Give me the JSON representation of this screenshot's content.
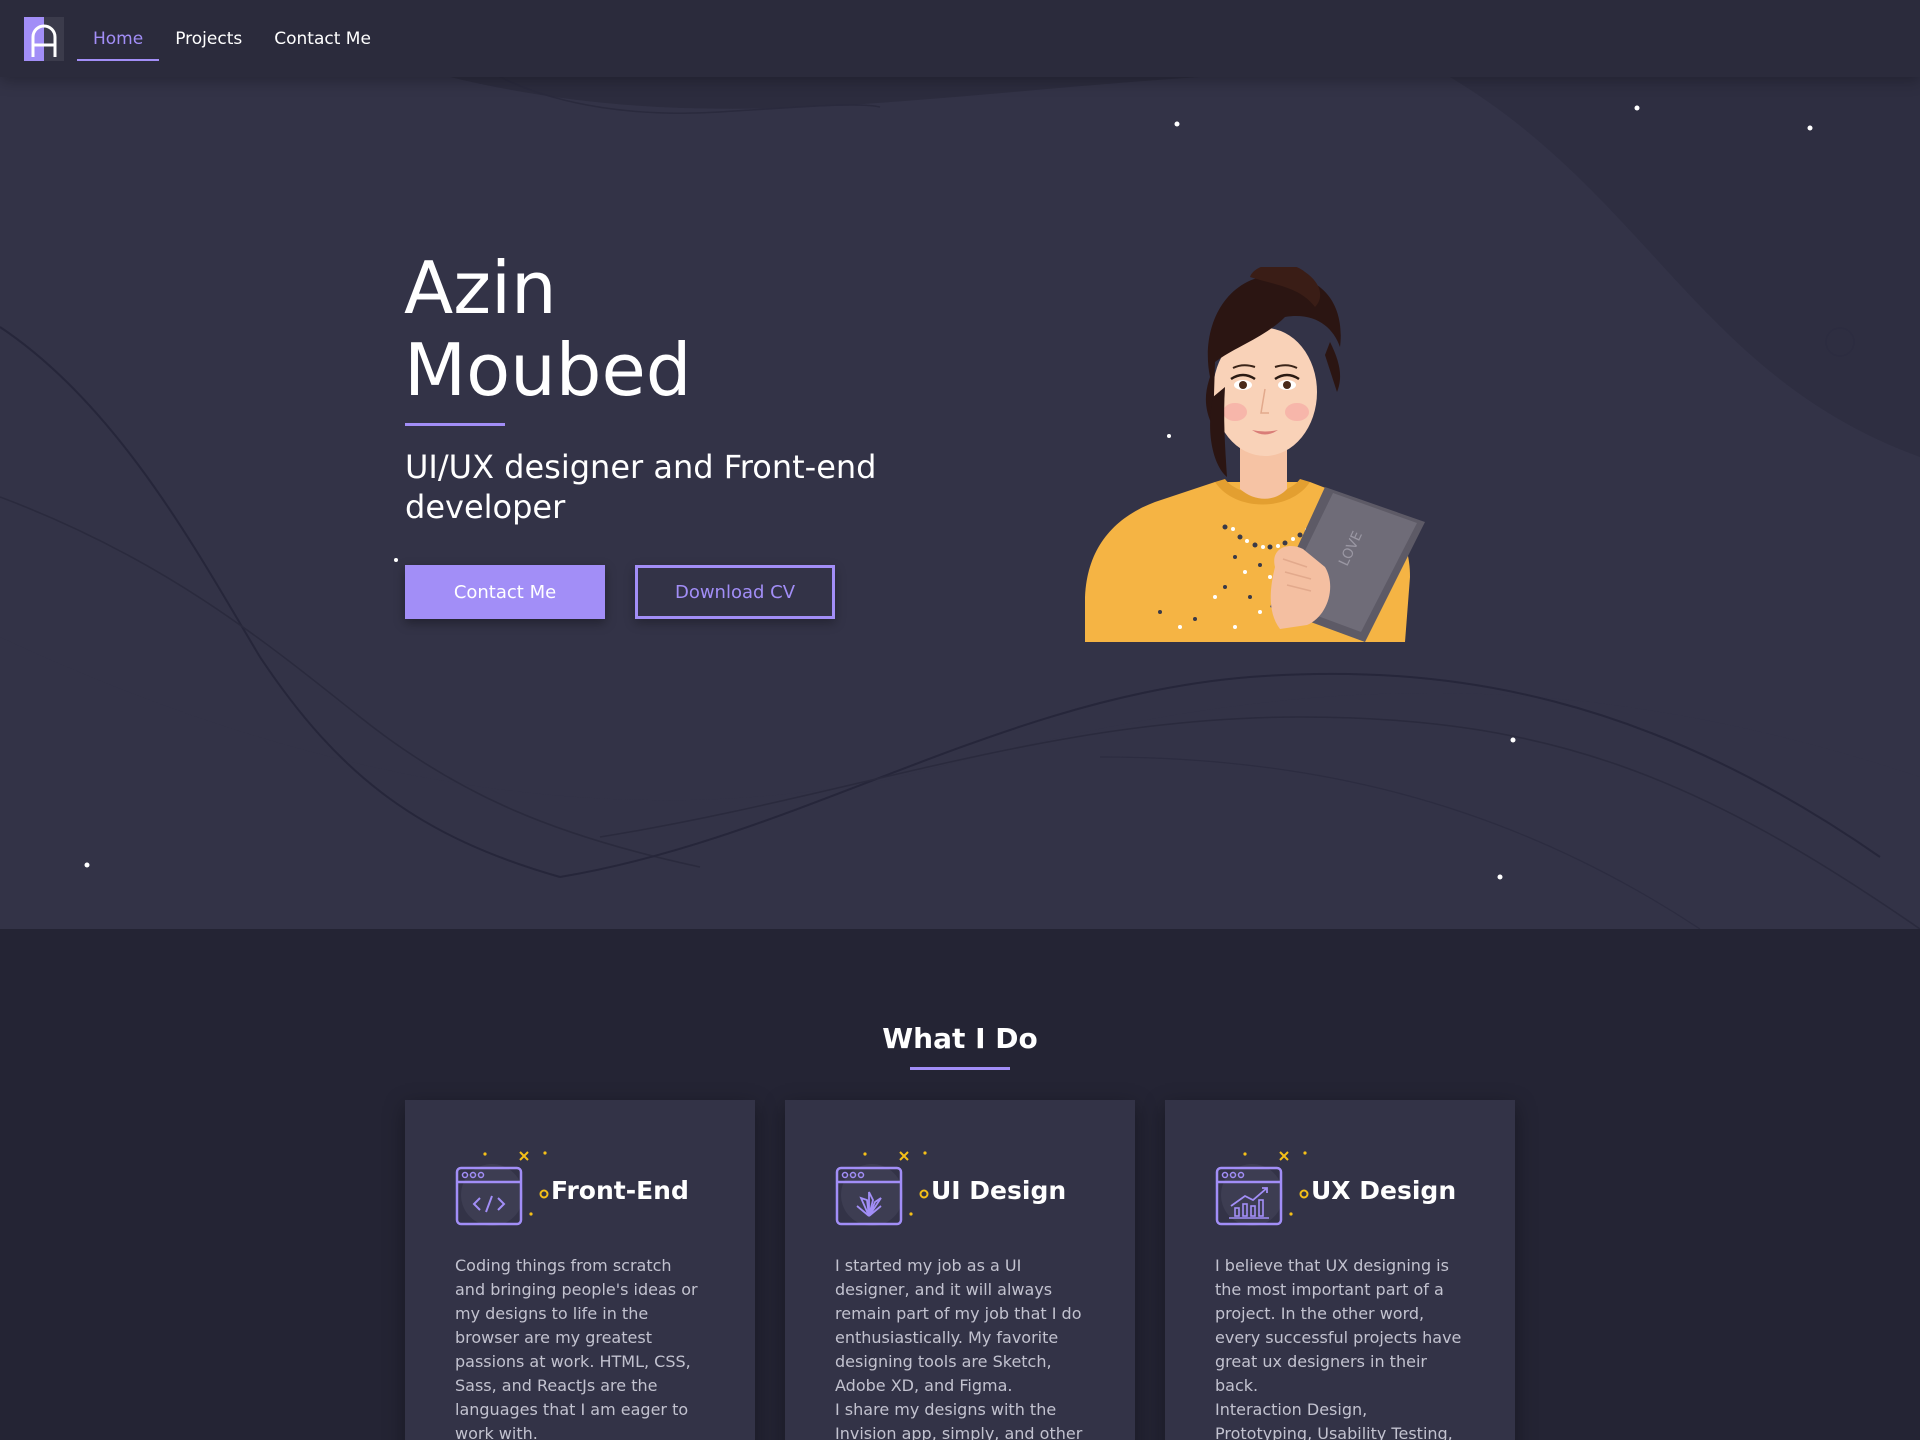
{
  "nav": {
    "logo_icon": "logo-a-icon",
    "items": [
      {
        "label": "Home",
        "active": true
      },
      {
        "label": "Projects",
        "active": false
      },
      {
        "label": "Contact Me",
        "active": false
      }
    ]
  },
  "hero": {
    "first_name": "Azin",
    "last_name": "Moubed",
    "subtitle": "UI/UX designer and Front-end developer",
    "primary_button": "Contact Me",
    "secondary_button": "Download CV",
    "portrait_icon": "portrait-illustration"
  },
  "what_i_do": {
    "title": "What I Do",
    "cards": [
      {
        "icon": "code-window-icon",
        "title": "Front-End",
        "text": "Coding things from scratch and bringing people's ideas or my designs to life in the browser are my greatest passions at work. HTML, CSS, Sass, and ReactJs are the languages that I am eager to work with.\nI try my best to stay updated and"
      },
      {
        "icon": "design-window-icon",
        "title": "UI Design",
        "text": "I started my job as a UI designer, and it will always remain part of my job that I do enthusiastically. My favorite designing tools are Sketch, Adobe XD, and Figma.\nI share my designs with the Invision app, simply, and other UI-sharing apps or websites. My"
      },
      {
        "icon": "chart-window-icon",
        "title": "UX Design",
        "text": "I believe that UX designing is the most important part of a project. In the other word, every successful projects have great ux designers in their back.\nInteraction Design, Prototyping, Usability Testing, wireframing, creating user persona, user flow,"
      }
    ]
  },
  "colors": {
    "accent": "#a28ef7",
    "hero_bg": "#333347",
    "page_bg": "#242434",
    "nav_bg": "#2b2b3c"
  }
}
